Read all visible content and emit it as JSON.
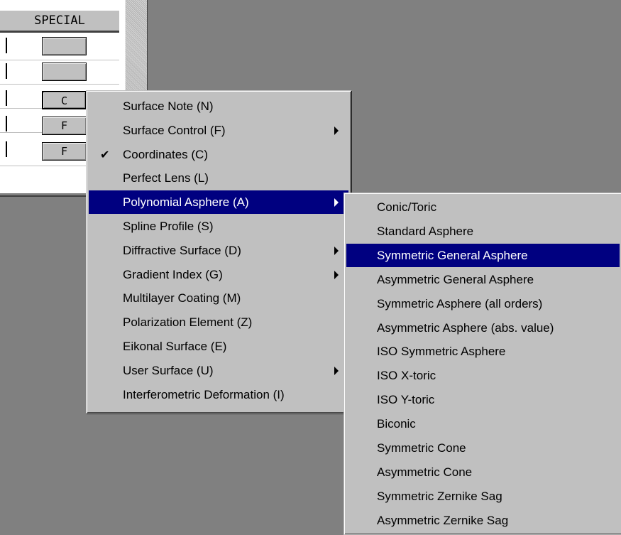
{
  "sheet": {
    "header": "SPECIAL",
    "cells": [
      "",
      "",
      "C",
      "F",
      "F"
    ]
  },
  "main_menu": {
    "items": [
      {
        "label": "Surface Note (N)",
        "submenu": false,
        "checked": false
      },
      {
        "label": "Surface Control (F)",
        "submenu": true,
        "checked": false
      },
      {
        "label": "Coordinates (C)",
        "submenu": false,
        "checked": true
      },
      {
        "label": "Perfect Lens (L)",
        "submenu": false,
        "checked": false
      },
      {
        "label": "Polynomial Asphere (A)",
        "submenu": true,
        "checked": false,
        "highlighted": true
      },
      {
        "label": "Spline Profile (S)",
        "submenu": false,
        "checked": false
      },
      {
        "label": "Diffractive Surface (D)",
        "submenu": true,
        "checked": false
      },
      {
        "label": "Gradient Index (G)",
        "submenu": true,
        "checked": false
      },
      {
        "label": "Multilayer Coating (M)",
        "submenu": false,
        "checked": false
      },
      {
        "label": "Polarization Element (Z)",
        "submenu": false,
        "checked": false
      },
      {
        "label": "Eikonal Surface (E)",
        "submenu": false,
        "checked": false
      },
      {
        "label": "User Surface (U)",
        "submenu": true,
        "checked": false
      },
      {
        "label": "Interferometric Deformation (I)",
        "submenu": false,
        "checked": false
      }
    ],
    "check_glyph": "✔"
  },
  "sub_menu": {
    "items": [
      {
        "label": "Conic/Toric"
      },
      {
        "label": "Standard Asphere"
      },
      {
        "label": "Symmetric General Asphere",
        "highlighted": true
      },
      {
        "label": "Asymmetric General Asphere"
      },
      {
        "label": "Symmetric Asphere (all orders)"
      },
      {
        "label": "Asymmetric Asphere (abs. value)"
      },
      {
        "label": "ISO Symmetric Asphere"
      },
      {
        "label": "ISO X-toric"
      },
      {
        "label": "ISO Y-toric"
      },
      {
        "label": "Biconic"
      },
      {
        "label": "Symmetric Cone"
      },
      {
        "label": "Asymmetric Cone"
      },
      {
        "label": "Symmetric Zernike Sag"
      },
      {
        "label": "Asymmetric Zernike Sag"
      }
    ]
  },
  "colors": {
    "highlight": "#000080",
    "menu_bg": "#c0c0c0",
    "desktop_bg": "#808080"
  }
}
